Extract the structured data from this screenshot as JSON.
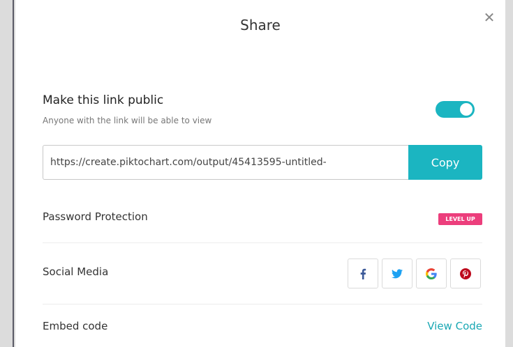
{
  "modal": {
    "title": "Share",
    "close_label": "✕"
  },
  "public_link": {
    "title": "Make this link public",
    "subtitle": "Anyone with the link will be able to view",
    "toggle_on": true,
    "url": "https://create.piktochart.com/output/45413595-untitled-",
    "copy_label": "Copy"
  },
  "rows": {
    "password_label": "Password Protection",
    "level_up_badge": "LEVEL UP",
    "social_label": "Social Media",
    "embed_label": "Embed code",
    "view_code_label": "View Code"
  },
  "social_icons": [
    "facebook-icon",
    "twitter-icon",
    "google-icon",
    "pinterest-icon"
  ],
  "colors": {
    "accent": "#1bb5c1",
    "badge": "#ec3e7c",
    "facebook": "#3b5998",
    "twitter": "#1da1f2",
    "pinterest": "#bd081c"
  }
}
